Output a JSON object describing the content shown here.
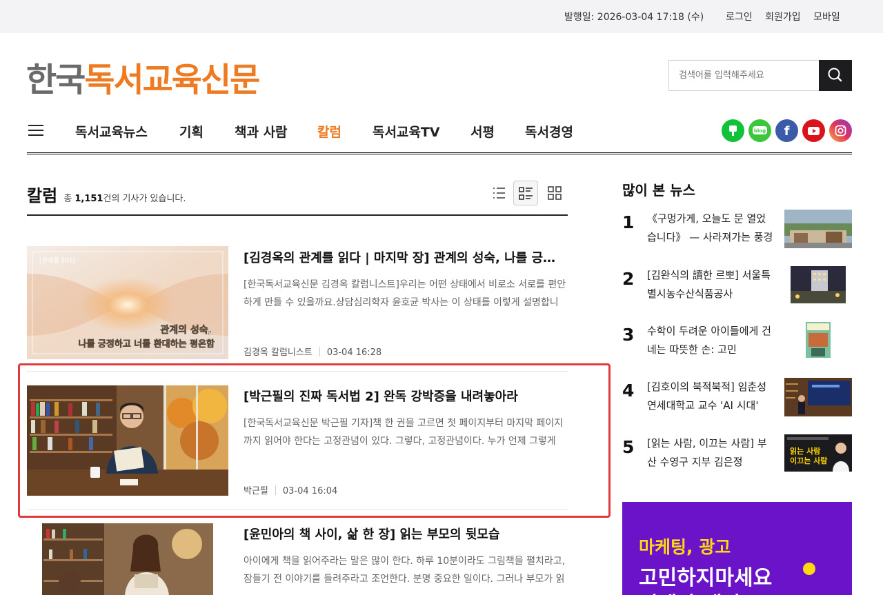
{
  "topbar": {
    "date": "발행일: 2026-03-04 17:18 (수)",
    "login": "로그인",
    "signup": "회원가입",
    "mobile": "모바일"
  },
  "logo": {
    "part1": "한국",
    "part2": "독서교육신문"
  },
  "search": {
    "placeholder": "검색어를 입력해주세요"
  },
  "nav": {
    "items": [
      "독서교육뉴스",
      "기획",
      "책과 사람",
      "칼럼",
      "독서교육TV",
      "서평",
      "독서경영"
    ],
    "active": "칼럼"
  },
  "social": [
    {
      "name": "kakao-story-icon",
      "color": "#10c23a"
    },
    {
      "name": "blog-icon",
      "color": "#3cc63c"
    },
    {
      "name": "facebook-icon",
      "color": "#3b5ba8"
    },
    {
      "name": "youtube-icon",
      "color": "#d9141b"
    },
    {
      "name": "instagram-icon",
      "color": "#d6297a"
    }
  ],
  "section": {
    "title": "칼럼",
    "count_prefix": "총 ",
    "count": "1,151",
    "count_suffix": "건의 기사가 있습니다."
  },
  "articles": [
    {
      "title": "[김경옥의 관계를 읽다 | 마지막 장] 관계의 성숙, 나를 긍정하고 너를 환대하는 평온함",
      "summary": "[한국독서교육신문 김경옥 칼럼니스트]우리는 어떤 상태에서 비로소 서로를 편안하게 만들 수 있을까요.상담심리학자 윤호균 박사는 이 상태를 이렇게 설명합니다.",
      "author": "김경옥 칼럼니스트",
      "date": "03-04 16:28",
      "thumb_tag": "[관계를 읽다]",
      "thumb_caption1": "관계의 성숙,",
      "thumb_caption2": "나를 긍정하고 너를 환대하는 평온함"
    },
    {
      "title": "[박근필의 진짜 독서법 2] 완독 강박증을 내려놓아라",
      "summary": "[한국독서교육신문 박근필 기자]책 한 권을 고르면 첫 페이지부터 마지막 페이지까지 읽어야 한다는 고정관념이 있다. 그렇다, 고정관념이다. 누가 언제 그렇게 정했는가.",
      "author": "박근필",
      "date": "03-04 16:04"
    },
    {
      "title": "[윤민아의 책 사이, 삶 한 장] 읽는 부모의 뒷모습",
      "summary": "아이에게 책을 읽어주라는 말은 많이 한다. 하루 10분이라도 그림책을 펼치라고, 잠들기 전 이야기를 들려주라고 조언한다. 분명 중요한 일이다. 그러나 부모가 읽는 모습은"
    }
  ],
  "popular": {
    "title": "많이 본 뉴스",
    "items": [
      {
        "num": "1",
        "text": "《구멍가게, 오늘도 문 열었습니다》 — 사라져가는 풍경"
      },
      {
        "num": "2",
        "text": "[김완식의 讀한 르뽀] 서울특별시농수산식품공사"
      },
      {
        "num": "3",
        "text": "수학이 두려운 아이들에게 건네는 따뜻한 손: 고민"
      },
      {
        "num": "4",
        "text": "[김호이의 북적북적] 임춘성 연세대학교 교수 'AI 시대'"
      },
      {
        "num": "5",
        "text": "[읽는 사람, 이끄는 사람] 부산 수영구 지부 김은정"
      }
    ],
    "badge5a": "읽는 사람",
    "badge5b": "이끄는 사람"
  },
  "ad": {
    "line1": "마케팅, 광고",
    "line2": "고민하지마세요",
    "line3": "언제나 생각"
  }
}
